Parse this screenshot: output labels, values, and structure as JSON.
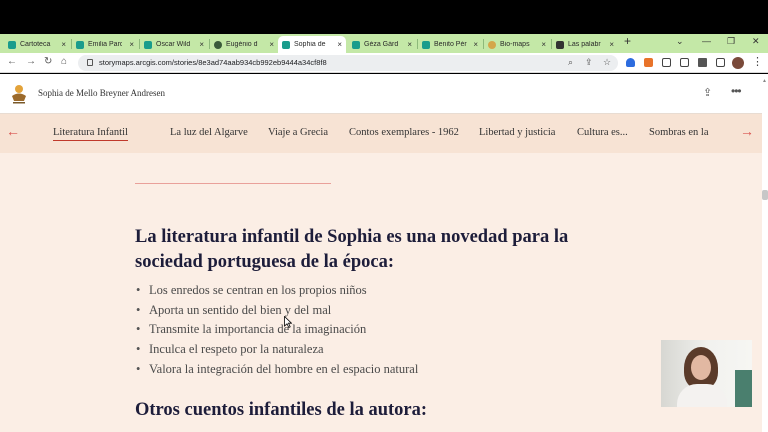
{
  "browser": {
    "tabs": [
      {
        "label": "Cartoteca",
        "color": "#1a9c8c"
      },
      {
        "label": "Emilia Pard",
        "color": "#1a9c8c"
      },
      {
        "label": "Óscar Wild",
        "color": "#1a9c8c"
      },
      {
        "label": "Eugénio d",
        "color": "#3a5a3a"
      },
      {
        "label": "Sophia de",
        "color": "#1a9c8c",
        "active": true
      },
      {
        "label": "Géza Gárdo",
        "color": "#1a9c8c"
      },
      {
        "label": "Benito Pér",
        "color": "#1a9c8c"
      },
      {
        "label": "Bio-maps",
        "color": "#d4a64a"
      },
      {
        "label": "Las palabr",
        "color": "#333333"
      }
    ],
    "url": "storymaps.arcgis.com/stories/8e3ad74aab934cb992eb9444a34cf8f8"
  },
  "site": {
    "title": "Sophia de Mello Breyner Andresen"
  },
  "nav": {
    "items": [
      "Literatura Infantil",
      "La luz del Algarve",
      "Viaje a Grecia",
      "Contos exemplares - 1962",
      "Libertad y justicia",
      "Cultura es...",
      "Sombras en la"
    ],
    "prev_arrow": "←",
    "next_arrow": "→"
  },
  "content": {
    "heading": "La literatura infantil de Sophia es una novedad para la sociedad portuguesa de la época:",
    "bullets": [
      "Los enredos se centran en los propios niños",
      "Aporta un sentido del bien y del mal",
      "Transmite la importancia de la imaginación",
      "Inculca el respeto por la naturaleza",
      "Valora la integración del hombre en el espacio natural"
    ],
    "heading2": "Otros cuentos infantiles de la autora:"
  },
  "colors": {
    "tab_strip": "#c4e8a7",
    "page_bg": "#fbeee5",
    "nav_bg": "#f7e3d4",
    "accent": "#d9534f",
    "heading": "#1d1d3a"
  }
}
